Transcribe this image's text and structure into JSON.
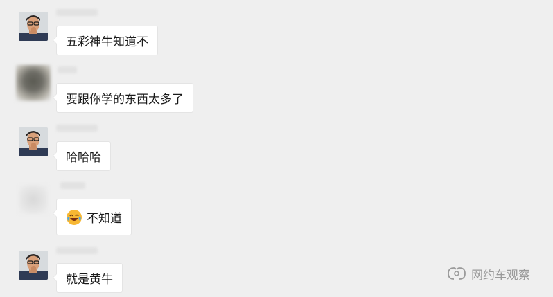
{
  "messages": [
    {
      "text": "五彩神牛知道不",
      "avatar": "person-avatar"
    },
    {
      "text": "要跟你学的东西太多了",
      "avatar": "blurred-avatar"
    },
    {
      "text": "哈哈哈",
      "avatar": "person-avatar"
    },
    {
      "text": "不知道",
      "avatar": "blurred-avatar",
      "emoji": "laughing-crying-emoji"
    },
    {
      "text": "就是黄牛",
      "avatar": "person-avatar"
    }
  ],
  "watermark": {
    "text": "网约车观察",
    "icon": "wechat-channel-icon"
  },
  "colors": {
    "background": "#efefef",
    "bubble": "#ffffff",
    "text": "#1a1a1a",
    "watermark": "#9a9a9a"
  }
}
